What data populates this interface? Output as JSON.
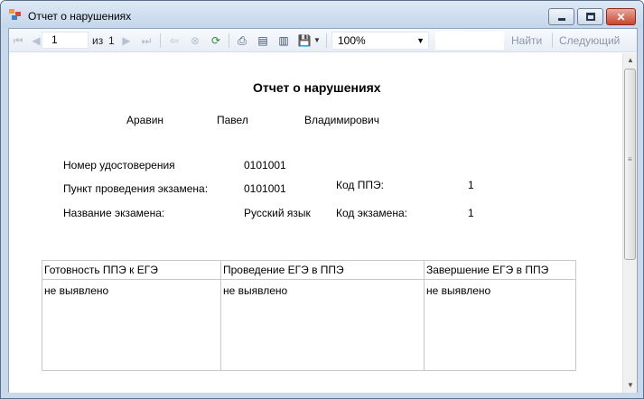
{
  "window": {
    "title": "Отчет о нарушениях",
    "buttons": {
      "minimize": "minimize",
      "maximize": "maximize",
      "close": "close"
    }
  },
  "toolbar": {
    "current_page": "1",
    "of_label": "из",
    "total_pages": "1",
    "zoom": "100%",
    "find_label": "Найти",
    "next_label": "Следующий",
    "icons": [
      "first-page-icon",
      "prev-page-icon",
      "next-page-icon",
      "last-page-icon",
      "back-icon",
      "stop-icon",
      "refresh-icon",
      "print-icon",
      "print-layout-icon",
      "page-setup-icon",
      "export-icon"
    ]
  },
  "report": {
    "title": "Отчет о  нарушениях",
    "person": {
      "last_name": "Аравин",
      "first_name": "Павел",
      "patronymic": "Владимирович"
    },
    "fields": {
      "certificate_label": "Номер удостоверения",
      "certificate_value": "0101001",
      "ppe_point_label": "Пункт проведения экзамена:",
      "ppe_point_value": "0101001",
      "exam_name_label": "Название экзамена:",
      "exam_name_value": "Русский язык",
      "ppe_code_label": "Код ППЭ:",
      "ppe_code_value": "1",
      "exam_code_label": "Код экзамена:",
      "exam_code_value": "1"
    },
    "table": {
      "columns": [
        {
          "header": "Готовность ППЭ к ЕГЭ",
          "value": "не выявлено"
        },
        {
          "header": "Проведение ЕГЭ в ППЭ",
          "value": "не выявлено"
        },
        {
          "header": "Завершение ЕГЭ в ППЭ",
          "value": "не выявлено"
        }
      ]
    }
  },
  "colors": {
    "titlebar": "#c5d6eb",
    "close_button": "#c7462f",
    "grid_border": "#c8c8c8"
  }
}
